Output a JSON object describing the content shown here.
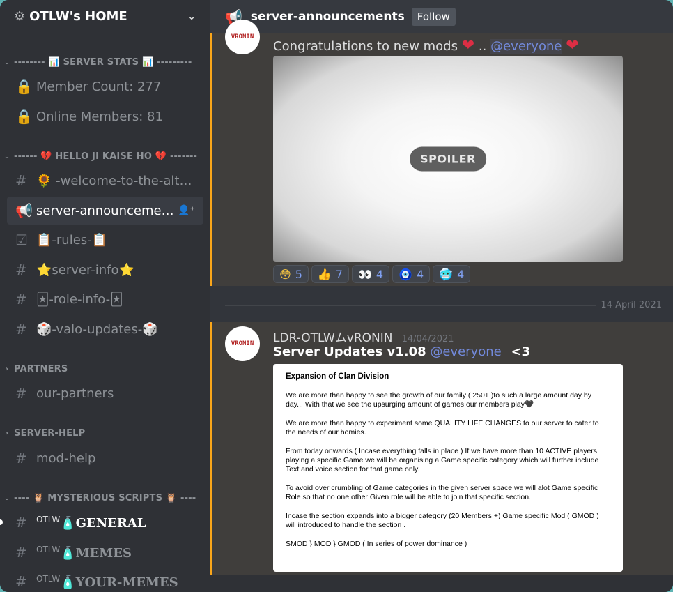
{
  "server": {
    "name": "OTLW's HOME"
  },
  "categories": {
    "stats": "-------- 📊 SERVER STATS 📊 ---------",
    "hello": "------ 💔 HELLO JI KAISE HO 💔 -------",
    "partners": "PARTNERS",
    "help": "SERVER-HELP",
    "scripts": "---- 🦉 MYSTERIOUS SCRIPTS 🦉 ----"
  },
  "channels": {
    "member_count": "Member Count: 277",
    "online_members": "Online Members: 81",
    "welcome": "🌻 -welcome-to-the-alternate-dimension",
    "announcements": "server-announcements",
    "rules": "📋-rules-📋",
    "server_info": "⭐server-info⭐",
    "role_info": "🃏-role-info-🃏",
    "valo_updates": "🎲-valo-updates-🎲",
    "partners": "our-partners",
    "mod_help": "mod-help",
    "general_prefix": "OTLW",
    "general_emoji": "🧴",
    "general": "GENERAL",
    "memes_prefix": "OTLW",
    "memes_emoji": "🧴",
    "memes": "MEMES",
    "your_memes_prefix": "OTLW",
    "your_memes_emoji": "🧴",
    "your_memes": "YOUR-MEMES"
  },
  "topbar": {
    "channel": "server-announcements",
    "follow": "Follow"
  },
  "message1": {
    "text_before": "Congratulations to new mods",
    "sep": "..",
    "mention": "@everyone",
    "spoiler": "SPOILER",
    "avatar": "VRONIN",
    "reactions": [
      {
        "emoji": "😳",
        "count": "5"
      },
      {
        "emoji": "👍",
        "count": "7"
      },
      {
        "emoji": "👀",
        "count": "4"
      },
      {
        "emoji": "🧿",
        "count": "4"
      },
      {
        "emoji": "🥶",
        "count": "4"
      }
    ]
  },
  "date_divider": "14 April 2021",
  "message2": {
    "author": "LDR-OTLWムvRONIN",
    "timestamp": "14/04/2021",
    "avatar": "VRONIN",
    "title": "Server Updates v1.08",
    "mention": "@everyone",
    "suffix": "<3",
    "doc": {
      "title": "Expansion of Clan Division",
      "p1": "We are more than happy to see the growth of our family ( 250+ )to such a large amount day by day... With that we see the upsurging amount of games our members play🖤",
      "p2": "We are more than happy to experiment some QUALITY LIFE CHANGES to our server to cater to the needs of our homies.",
      "p3": "From today onwards ( Incase everything falls in place ) If we have more than 10 ACTIVE players playing a specific Game we will be organising a Game specific category which will further include Text and voice section for that game only.",
      "p4": "To avoid over crumbling of Game categories in the given server space we will alot Game specific Role so that no one other Given role will be able to join that specific section.",
      "p5": "Incase the section expands into a bigger category (20 Members +) Game specific Mod ( GMOD ) will introduced to handle the section .",
      "p6": "SMOD } MOD } GMOD ( In series of power dominance )"
    }
  }
}
